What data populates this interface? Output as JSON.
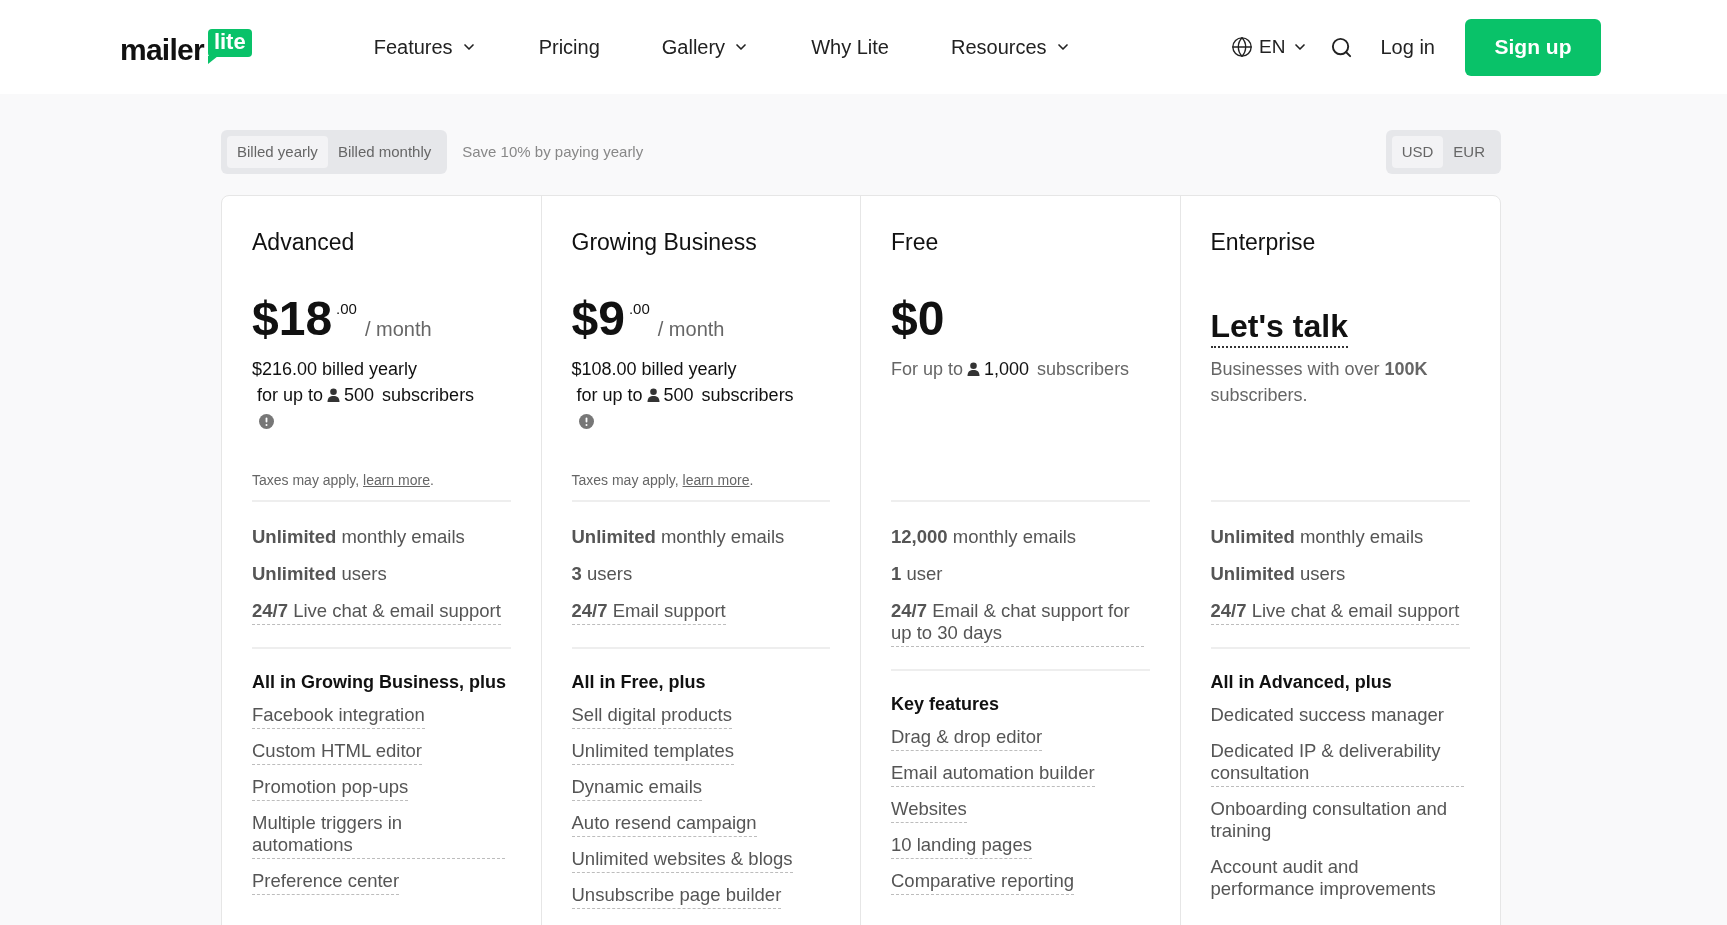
{
  "nav": {
    "logo": {
      "word": "mailer",
      "badge": "lite"
    },
    "links": [
      {
        "label": "Features",
        "dropdown": true
      },
      {
        "label": "Pricing",
        "dropdown": false
      },
      {
        "label": "Gallery",
        "dropdown": true
      },
      {
        "label": "Why Lite",
        "dropdown": false
      },
      {
        "label": "Resources",
        "dropdown": true
      }
    ],
    "language": "EN",
    "login": "Log in",
    "signup": "Sign up"
  },
  "billing": {
    "options": [
      {
        "label": "Billed yearly",
        "selected": true
      },
      {
        "label": "Billed monthly",
        "selected": false
      }
    ],
    "note": "Save 10% by paying yearly"
  },
  "currency": [
    {
      "label": "USD",
      "selected": true
    },
    {
      "label": "EUR",
      "selected": false
    }
  ],
  "plans": [
    {
      "name": "Advanced",
      "price": {
        "kind": "amount",
        "main": "$18",
        "cents": ".00",
        "period": "/ month"
      },
      "billed": "$216.00 billed yearly",
      "subscribers": {
        "prefix": "for up to",
        "count": "500",
        "suffix": "subscribers",
        "muted": false,
        "info": true
      },
      "taxes": {
        "text": "Taxes may apply,",
        "link": "learn more",
        "end": "."
      },
      "limits": [
        {
          "text": "**Unlimited** monthly emails",
          "underlined": false
        },
        {
          "text": "**Unlimited** users",
          "underlined": false
        },
        {
          "text": "**24/7** Live chat & email support",
          "underlined": true
        }
      ],
      "section": "All in Growing Business, plus",
      "features": [
        {
          "text": "Facebook integration",
          "underlined": true
        },
        {
          "text": "Custom HTML editor",
          "underlined": true
        },
        {
          "text": "Promotion pop-ups",
          "underlined": true
        },
        {
          "text": "Multiple triggers in automations",
          "underlined": true
        },
        {
          "text": "Preference center",
          "underlined": true
        }
      ]
    },
    {
      "name": "Growing Business",
      "price": {
        "kind": "amount",
        "main": "$9",
        "cents": ".00",
        "period": "/ month"
      },
      "billed": "$108.00 billed yearly",
      "subscribers": {
        "prefix": "for up to",
        "count": "500",
        "suffix": "subscribers",
        "muted": false,
        "info": true
      },
      "taxes": {
        "text": "Taxes may apply,",
        "link": "learn more",
        "end": "."
      },
      "limits": [
        {
          "text": "**Unlimited** monthly emails",
          "underlined": false
        },
        {
          "text": "**3** users",
          "underlined": false
        },
        {
          "text": "**24/7** Email support",
          "underlined": true
        }
      ],
      "section": "All in Free, plus",
      "features": [
        {
          "text": "Sell digital products",
          "underlined": true
        },
        {
          "text": "Unlimited templates",
          "underlined": true
        },
        {
          "text": "Dynamic emails",
          "underlined": true
        },
        {
          "text": "Auto resend campaign",
          "underlined": true
        },
        {
          "text": "Unlimited websites & blogs",
          "underlined": true
        },
        {
          "text": "Unsubscribe page builder",
          "underlined": true
        }
      ]
    },
    {
      "name": "Free",
      "price": {
        "kind": "amount",
        "main": "$0"
      },
      "subscribers": {
        "prefix": "For up to",
        "count": "1,000",
        "suffix": "subscribers",
        "muted": true,
        "info": false
      },
      "limits": [
        {
          "text": "**12,000** monthly emails",
          "underlined": false
        },
        {
          "text": "**1** user",
          "underlined": false
        },
        {
          "text": "**24/7** Email & chat support for up to 30 days",
          "underlined": true
        }
      ],
      "section": "Key features",
      "features": [
        {
          "text": "Drag & drop editor",
          "underlined": true
        },
        {
          "text": "Email automation builder",
          "underlined": true
        },
        {
          "text": "Websites",
          "underlined": true
        },
        {
          "text": "10 landing pages",
          "underlined": true
        },
        {
          "text": "Comparative reporting",
          "underlined": true
        }
      ]
    },
    {
      "name": "Enterprise",
      "price": {
        "kind": "talk",
        "main": "Let's talk"
      },
      "description": "Businesses with over **100K** subscribers.",
      "limits": [
        {
          "text": "**Unlimited** monthly emails",
          "underlined": false
        },
        {
          "text": "**Unlimited** users",
          "underlined": false
        },
        {
          "text": "**24/7** Live chat & email support",
          "underlined": true
        }
      ],
      "section": "All in Advanced, plus",
      "features": [
        {
          "text": "Dedicated success manager",
          "underlined": false
        },
        {
          "text": "Dedicated IP & deliverability consultation",
          "underlined": true
        },
        {
          "text": "Onboarding consultation and training",
          "underlined": false
        },
        {
          "text": "Account audit and performance improvements",
          "underlined": false
        }
      ]
    }
  ]
}
